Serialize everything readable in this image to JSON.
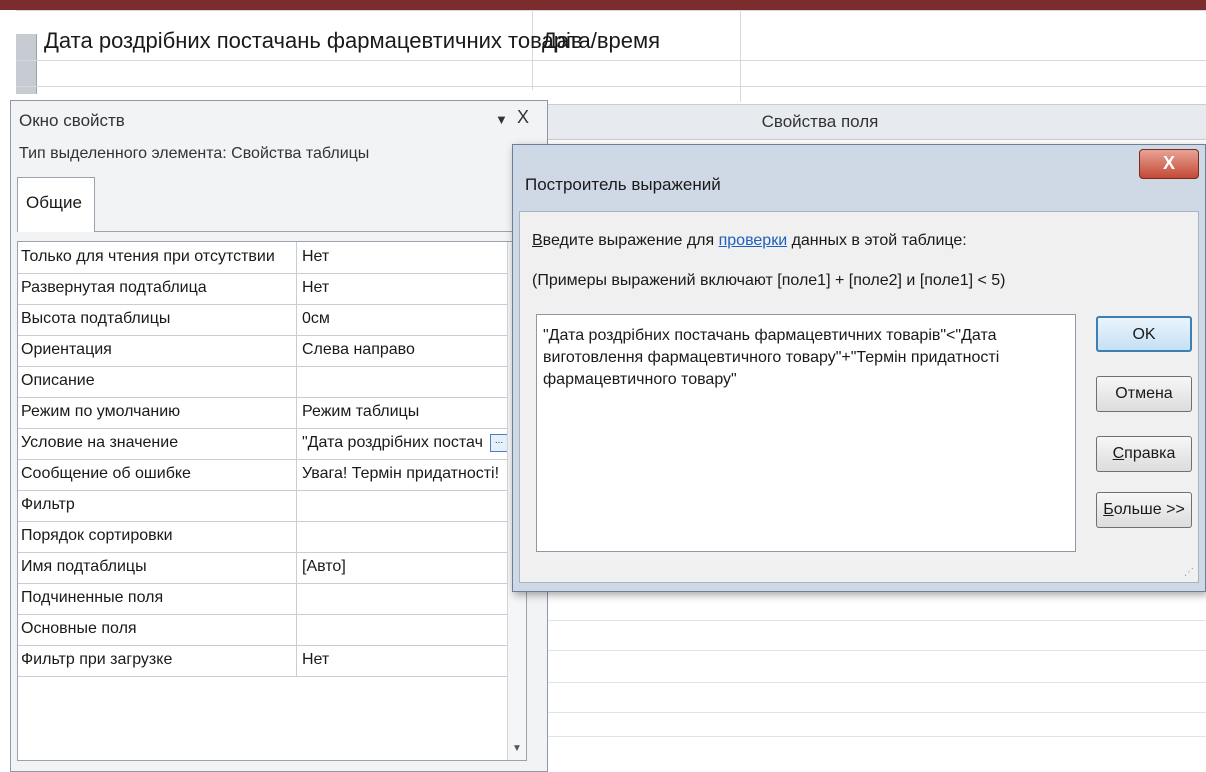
{
  "design": {
    "field_name": "Дата роздрібних постачань фармацевтичних товарів",
    "field_type": "Дата/время",
    "field_properties_header": "Свойства поля"
  },
  "property_sheet": {
    "title": "Окно свойств",
    "dropdown_glyph": "▼",
    "close_glyph": "X",
    "selection_type": "Тип выделенного элемента:  Свойства таблицы",
    "tab_general": "Общие",
    "rows": [
      {
        "name": "Только для чтения при отсутствии",
        "value": "Нет"
      },
      {
        "name": "Развернутая подтаблица",
        "value": "Нет"
      },
      {
        "name": "Высота подтаблицы",
        "value": "0см"
      },
      {
        "name": "Ориентация",
        "value": "Слева направо"
      },
      {
        "name": "Описание",
        "value": ""
      },
      {
        "name": "Режим по умолчанию",
        "value": "Режим таблицы"
      },
      {
        "name": "Условие на значение",
        "value": "\"Дата роздрібних постач"
      },
      {
        "name": "Сообщение об ошибке",
        "value": "Увага! Термін придатності!"
      },
      {
        "name": "Фильтр",
        "value": ""
      },
      {
        "name": "Порядок сортировки",
        "value": ""
      },
      {
        "name": "Имя подтаблицы",
        "value": "[Авто]"
      },
      {
        "name": "Подчиненные поля",
        "value": ""
      },
      {
        "name": "Основные поля",
        "value": ""
      },
      {
        "name": "Фильтр при загрузке",
        "value": "Нет"
      }
    ],
    "build_button": "..."
  },
  "dialog": {
    "title": "Построитель выражений",
    "close": "X",
    "instr_v": "В",
    "instr_rest": "ведите выражение для ",
    "instr_link": "проверки",
    "instr_tail": " данных в этой таблице:",
    "examples": "(Примеры выражений включают [поле1] + [поле2] и [поле1] < 5)",
    "expression": "\"Дата роздрібних постачань фармацевтичних товарів\"<\"Дата виготовлення фармацевтичного товару\"+\"Термін придатності фармацевтичного товару\"",
    "ok": "OK",
    "cancel": "Отмена",
    "help_s": "С",
    "help_rest": "правка",
    "more_b": "Б",
    "more_rest": "ольше >>"
  }
}
